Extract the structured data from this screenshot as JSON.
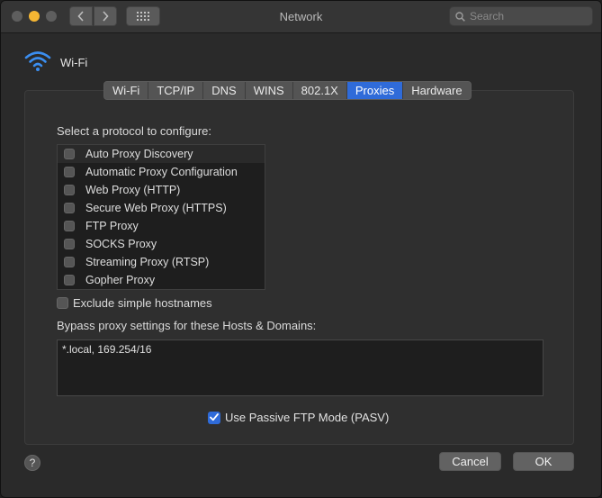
{
  "window": {
    "title": "Network"
  },
  "search": {
    "placeholder": "Search"
  },
  "interface": {
    "name": "Wi-Fi"
  },
  "tabs": [
    {
      "label": "Wi-Fi",
      "active": false
    },
    {
      "label": "TCP/IP",
      "active": false
    },
    {
      "label": "DNS",
      "active": false
    },
    {
      "label": "WINS",
      "active": false
    },
    {
      "label": "802.1X",
      "active": false
    },
    {
      "label": "Proxies",
      "active": true
    },
    {
      "label": "Hardware",
      "active": false
    }
  ],
  "proxies": {
    "select_label": "Select a protocol to configure:",
    "protocols": [
      {
        "label": "Auto Proxy Discovery",
        "checked": false
      },
      {
        "label": "Automatic Proxy Configuration",
        "checked": false
      },
      {
        "label": "Web Proxy (HTTP)",
        "checked": false
      },
      {
        "label": "Secure Web Proxy (HTTPS)",
        "checked": false
      },
      {
        "label": "FTP Proxy",
        "checked": false
      },
      {
        "label": "SOCKS Proxy",
        "checked": false
      },
      {
        "label": "Streaming Proxy (RTSP)",
        "checked": false
      },
      {
        "label": "Gopher Proxy",
        "checked": false
      }
    ],
    "exclude_label": "Exclude simple hostnames",
    "exclude_checked": false,
    "bypass_label": "Bypass proxy settings for these Hosts & Domains:",
    "bypass_value": "*.local, 169.254/16",
    "pasv_label": "Use Passive FTP Mode (PASV)",
    "pasv_checked": true
  },
  "footer": {
    "help": "?",
    "cancel_label": "Cancel",
    "ok_label": "OK"
  },
  "colors": {
    "accent": "#2f6bd9",
    "wifi": "#3b8ef0"
  },
  "icons": [
    "close-light",
    "minimize-light",
    "zoom-light",
    "back-icon",
    "forward-icon",
    "grid-icon",
    "search-icon",
    "wifi-icon",
    "help-icon",
    "checkmark-icon"
  ]
}
